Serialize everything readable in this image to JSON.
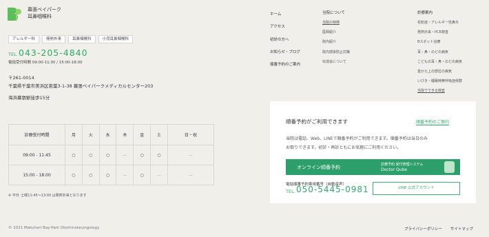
{
  "clinic": {
    "name": "幕張ベイパーク",
    "subtitle": "耳鼻咽喉科",
    "colors": {
      "brand": "#2eaa67",
      "background": "#f0efea"
    }
  },
  "tags": [
    "アレルギー科",
    "発熱外来",
    "耳鼻咽喉科",
    "小児耳鼻咽喉科"
  ],
  "contact": {
    "tel_prefix": "TEL.",
    "tel": "043-205-4840",
    "hours": "電話受付時間 09:00-11:30 / 15:00-18:00",
    "postal": "〒261-0014",
    "address": "千葉県千葉市美浜区若葉3-1-38 幕張ベイパークメディカルセンター203",
    "access": "海浜幕張駅徒歩15分"
  },
  "schedule": {
    "header": [
      "診療受付時間",
      "月",
      "火",
      "水",
      "木",
      "金",
      "土",
      "日・祝"
    ],
    "rows": [
      [
        "09:00 - 11:45",
        "○",
        "○",
        "○",
        "—",
        "○",
        "○",
        "—"
      ],
      [
        "15:00 - 18:00",
        "○",
        "○",
        "○",
        "—",
        "○",
        "—",
        "—"
      ]
    ],
    "note": "※ 平日･土曜11:45〜13:00 は発熱外来となります"
  },
  "nav": {
    "main": [
      "ホーム",
      "アクセス",
      "初診の方へ",
      "お知らせ・ブログ",
      "順番予約のご案内"
    ],
    "about": {
      "head": "当院について",
      "items": [
        "当院の特徴",
        "医師紹介",
        "院内紹介",
        "院内感染防止対策",
        "伝達会について"
      ]
    },
    "services": {
      "head": "診療案内",
      "items": [
        "花粉症・アレルギー性鼻炎",
        "発熱外来・PCR検査",
        "Bスポット治療",
        "耳・鼻・のどの病気",
        "こどもの耳・鼻・のどの病気",
        "首から上の部位の病気",
        "いびき・睡眠時無呼吸症候群",
        "当院でできる検査"
      ]
    }
  },
  "reservation": {
    "title": "順番予約がご利用できます",
    "link": "順番予約のご案内",
    "desc1": "当院は電話、Web、LINEで順番予約がご利用できます。順番予約は当日のみ",
    "desc2": "お取りできます。初診・再診ともにお気軽にご利用ください。",
    "banner_left": "オンライン順番予約",
    "banner_right_1": "診療予約 受付管理システム",
    "banner_right_2": "Doctor Qube",
    "phone_label": "電話順番予約専用番号（自動音声）",
    "phone_prefix": "TEL.",
    "phone": "050-5445-0981",
    "line_button": "LINE 公式アカウント"
  },
  "footer": {
    "copyright": "© 2021 Makuhari Bay-Park Otorhinolaryngology",
    "links": [
      "プライバシーポリシー",
      "サイトマップ"
    ]
  }
}
